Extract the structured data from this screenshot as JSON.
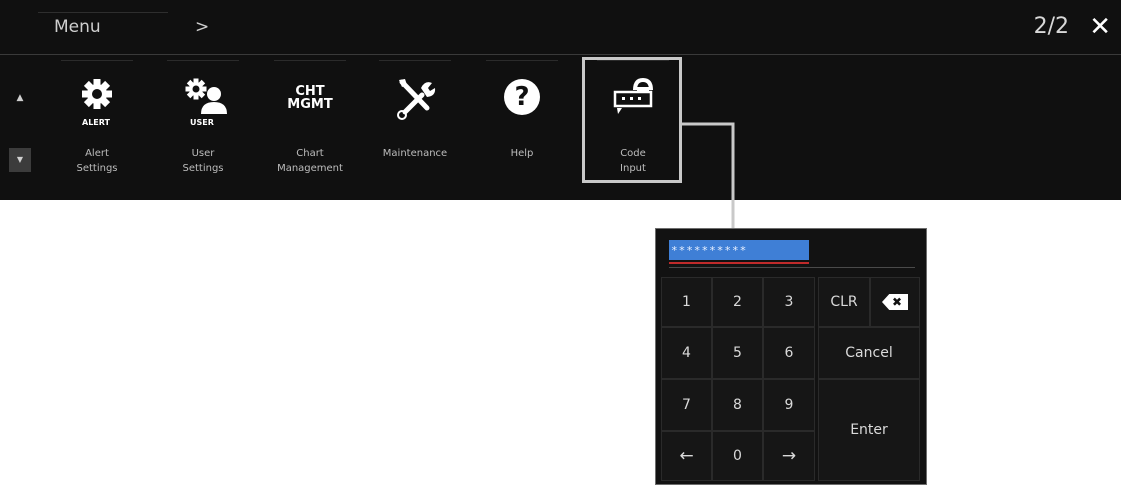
{
  "header": {
    "title": "Menu",
    "arrow": ">",
    "page_indicator": "2/2",
    "close": "✕"
  },
  "scroll": {
    "up": "▲",
    "down": "▼"
  },
  "items": [
    {
      "badge": "ALERT",
      "label": "Alert\nSettings",
      "icon": "gear-icon"
    },
    {
      "badge": "USER",
      "label": "User\nSettings",
      "icon": "user-gear-icon"
    },
    {
      "icon_text_1": "CHT",
      "icon_text_2": "MGMT",
      "label": "Chart\nManagement",
      "icon": "chart-management-icon"
    },
    {
      "label": "Maintenance",
      "icon": "tools-icon"
    },
    {
      "icon_text": "?",
      "label": "Help",
      "icon": "help-icon"
    },
    {
      "label": "Code\nInput",
      "icon": "code-input-icon"
    }
  ],
  "keypad": {
    "code_value": "**********",
    "keys": [
      "1",
      "2",
      "3",
      "4",
      "5",
      "6",
      "7",
      "8",
      "9",
      "←",
      "0",
      "→"
    ],
    "clr": "CLR",
    "backspace": "✖",
    "cancel": "Cancel",
    "enter": "Enter"
  }
}
